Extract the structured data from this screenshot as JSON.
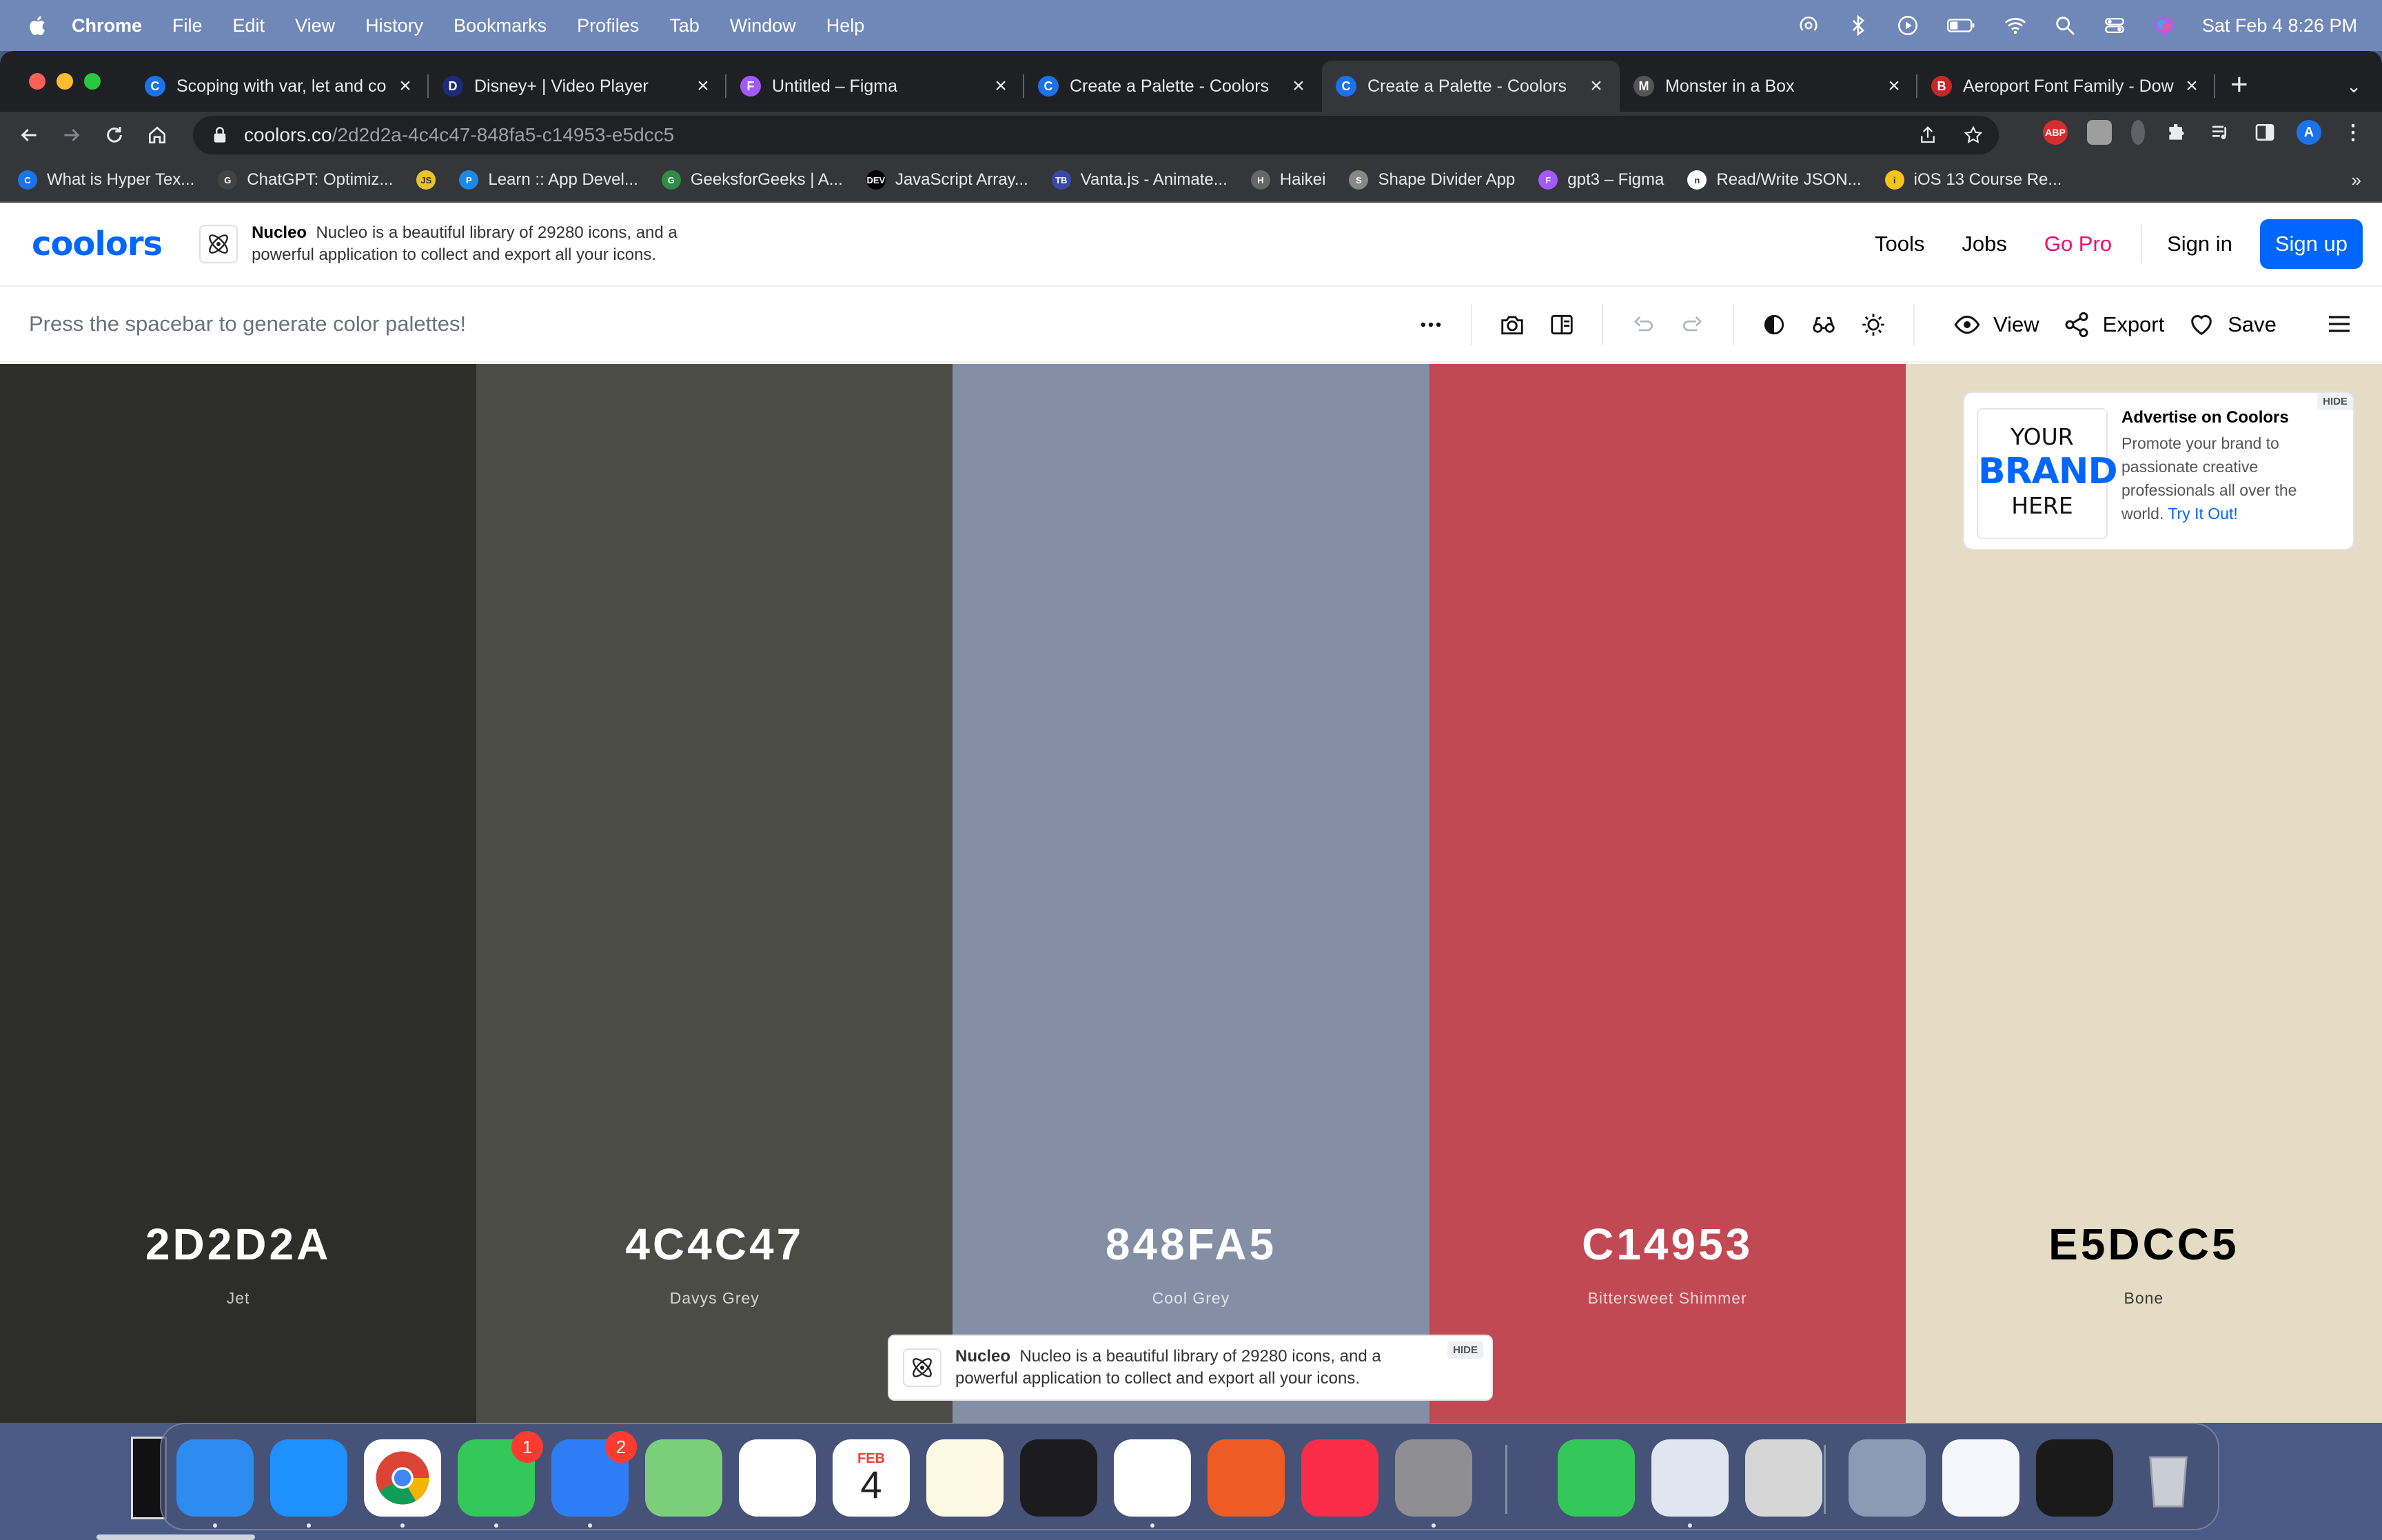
{
  "menubar": {
    "app": "Chrome",
    "items": [
      "File",
      "Edit",
      "View",
      "History",
      "Bookmarks",
      "Profiles",
      "Tab",
      "Window",
      "Help"
    ],
    "clock": "Sat Feb 4  8:26 PM"
  },
  "browser": {
    "tabs": [
      {
        "title": "Scoping with var, let and co",
        "icon_color": "#1a73e8",
        "icon_letter": "C"
      },
      {
        "title": "Disney+ | Video Player",
        "icon_color": "#1c2b7a",
        "icon_letter": "D"
      },
      {
        "title": "Untitled – Figma",
        "icon_color": "#a259ff",
        "icon_letter": "F"
      },
      {
        "title": "Create a Palette - Coolors",
        "icon_color": "#1a73e8",
        "icon_letter": "C"
      },
      {
        "title": "Create a Palette - Coolors",
        "icon_color": "#1a73e8",
        "icon_letter": "C"
      },
      {
        "title": "Monster in a Box",
        "icon_color": "#555555",
        "icon_letter": "M"
      },
      {
        "title": "Aeroport Font Family - Dow",
        "icon_color": "#c62828",
        "icon_letter": "B"
      }
    ],
    "active_tab": 4,
    "url_host": "coolors.co",
    "url_path": "/2d2d2a-4c4c47-848fa5-c14953-e5dcc5",
    "bookmarks": [
      {
        "label": "What is Hyper Tex...",
        "color": "#1a73e8",
        "letter": "C"
      },
      {
        "label": "ChatGPT: Optimiz...",
        "color": "#444444",
        "letter": "G"
      },
      {
        "label": "",
        "color": "#e8c32c",
        "letter": "JS"
      },
      {
        "label": "Learn :: App Devel...",
        "color": "#1e88e5",
        "letter": "P"
      },
      {
        "label": "GeeksforGeeks | A...",
        "color": "#2f8d46",
        "letter": "G"
      },
      {
        "label": "JavaScript Array...",
        "color": "#000000",
        "letter": "DEV"
      },
      {
        "label": "Vanta.js - Animate...",
        "color": "#3949ab",
        "letter": "TB"
      },
      {
        "label": "Haikei",
        "color": "#666666",
        "letter": "H"
      },
      {
        "label": "Shape Divider App",
        "color": "#888888",
        "letter": "S"
      },
      {
        "label": "gpt3 – Figma",
        "color": "#a259ff",
        "letter": "F"
      },
      {
        "label": "Read/Write JSON...",
        "color": "#ffffff",
        "letter": "n"
      },
      {
        "label": "iOS 13 Course Re...",
        "color": "#f5c518",
        "letter": "i"
      }
    ],
    "bookmarks_more": "»"
  },
  "coolors": {
    "logo": "coolors",
    "header_ad": {
      "brand": "Nucleo",
      "text": "Nucleo is a beautiful library of 29280 icons, and a powerful application to collect and export all your icons."
    },
    "nav": {
      "tools": "Tools",
      "jobs": "Jobs",
      "go_pro": "Go Pro",
      "sign_in": "Sign in",
      "sign_up": "Sign up"
    },
    "hint": "Press the spacebar to generate color palettes!",
    "actions": {
      "view": "View",
      "export": "Export",
      "save": "Save"
    },
    "palette": [
      {
        "hex": "2D2D2A",
        "name": "Jet",
        "color": "#2d2d2a",
        "text_color": "#ffffff"
      },
      {
        "hex": "4C4C47",
        "name": "Davys Grey",
        "color": "#4c4c47",
        "text_color": "#ffffff"
      },
      {
        "hex": "848FA5",
        "name": "Cool Grey",
        "color": "#848fa5",
        "text_color": "#ffffff"
      },
      {
        "hex": "C14953",
        "name": "Bittersweet Shimmer",
        "color": "#c14953",
        "text_color": "#ffffff"
      },
      {
        "hex": "E5DCC5",
        "name": "Bone",
        "color": "#e5dcc5",
        "text_color": "#000000"
      }
    ],
    "side_ad": {
      "brand_l1": "YOUR",
      "brand_l2": "BRAND",
      "brand_l3": "HERE",
      "title": "Advertise on Coolors",
      "body": "Promote your brand to passionate creative professionals all over the world.",
      "link": "Try It Out!",
      "hide": "HIDE"
    },
    "bottom_ad": {
      "brand": "Nucleo",
      "text": "Nucleo is a beautiful library of 29280 icons, and a powerful application to collect and export all your icons.",
      "hide": "HIDE"
    }
  },
  "dock": {
    "apps": [
      {
        "name": "finder",
        "color": "#2d8cf0",
        "running": true,
        "badge": ""
      },
      {
        "name": "safari",
        "color": "#1e90ff",
        "running": true,
        "badge": ""
      },
      {
        "name": "chrome",
        "color": "#ffffff",
        "running": true,
        "badge": ""
      },
      {
        "name": "messages",
        "color": "#34c759",
        "running": true,
        "badge": "1"
      },
      {
        "name": "mail",
        "color": "#2f7df6",
        "running": true,
        "badge": "2"
      },
      {
        "name": "maps",
        "color": "#7ccf7a",
        "running": false,
        "badge": ""
      },
      {
        "name": "photos",
        "color": "#ffffff",
        "running": false,
        "badge": ""
      },
      {
        "name": "calendar",
        "color": "#ffffff",
        "running": false,
        "badge": ""
      },
      {
        "name": "notes",
        "color": "#fef9e3",
        "running": false,
        "badge": ""
      },
      {
        "name": "craft",
        "color": "#1c1c1e",
        "running": false,
        "badge": ""
      },
      {
        "name": "vscode",
        "color": "#ffffff",
        "running": true,
        "badge": ""
      },
      {
        "name": "postman",
        "color": "#ef5b25",
        "running": false,
        "badge": ""
      },
      {
        "name": "music",
        "color": "#fa2d48",
        "running": false,
        "badge": ""
      },
      {
        "name": "system-settings",
        "color": "#8e8e93",
        "running": true,
        "badge": ""
      },
      {
        "name": "facetime",
        "color": "#34c759",
        "running": false,
        "badge": ""
      },
      {
        "name": "preview",
        "color": "#dfe6f2",
        "running": true,
        "badge": ""
      },
      {
        "name": "font-book",
        "color": "#d6d6d6",
        "running": false,
        "badge": ""
      },
      {
        "name": "window-thumb-1",
        "color": "#8b9bb6",
        "running": false,
        "badge": ""
      },
      {
        "name": "window-thumb-2",
        "color": "#f4f6fb",
        "running": false,
        "badge": ""
      },
      {
        "name": "window-thumb-3",
        "color": "#1a1a1a",
        "running": false,
        "badge": ""
      },
      {
        "name": "trash",
        "color": "#c8cdd6",
        "running": false,
        "badge": ""
      }
    ],
    "calendar_month": "FEB",
    "calendar_day": "4"
  }
}
